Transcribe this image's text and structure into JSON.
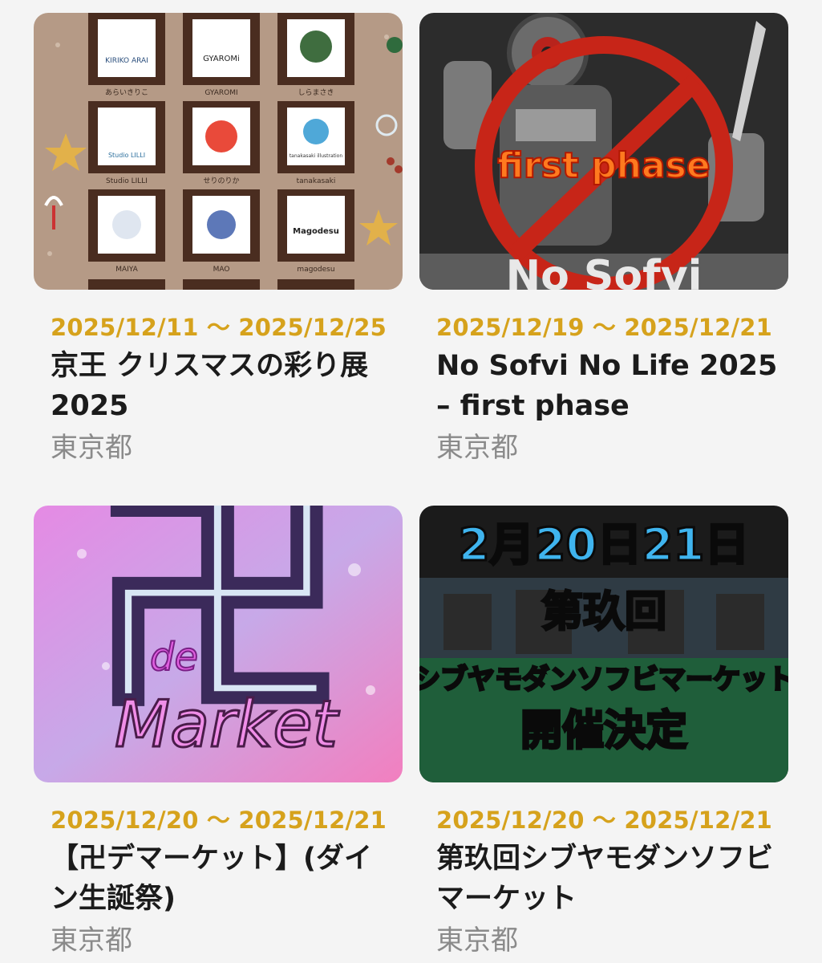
{
  "events": [
    {
      "date": "2025/12/11 〜 2025/12/25",
      "title": "京王 クリスマスの彩り展 2025",
      "location": "東京都",
      "image": {
        "artists": [
          {
            "label": "あらいきりこ",
            "badge": "KIRIKO ARAI"
          },
          {
            "label": "GYAROMI",
            "badge": "GYAROMi"
          },
          {
            "label": "しらまさき",
            "badge": ""
          },
          {
            "label": "Studio LILLI",
            "badge": "Studio LILLI"
          },
          {
            "label": "せりのりか",
            "badge": ""
          },
          {
            "label": "tanakasaki",
            "badge": "tanakasaki illustration"
          },
          {
            "label": "MAIYA",
            "badge": ""
          },
          {
            "label": "MAO",
            "badge": ""
          },
          {
            "label": "magodesu",
            "badge": "Magodesu"
          }
        ]
      }
    },
    {
      "date": "2025/12/19 〜 2025/12/21",
      "title": "No Sofvi No Life 2025 – first phase",
      "location": "東京都",
      "image": {
        "overlay_text": "first phase",
        "bottom_text": "No Sofvi"
      }
    },
    {
      "date": "2025/12/20 〜 2025/12/21",
      "title": "【卍デマーケット】(ダイン生誕祭)",
      "location": "東京都",
      "image": {
        "symbol": "卍",
        "small": "de",
        "word": "Market"
      }
    },
    {
      "date": "2025/12/20 〜 2025/12/21",
      "title": "第玖回シブヤモダンソフビマーケット",
      "location": "東京都",
      "image": {
        "line1": "2月20日21日",
        "line2": "第玖回",
        "line3": "シブヤモダンソフビマーケット",
        "line4": "開催決定"
      }
    }
  ]
}
